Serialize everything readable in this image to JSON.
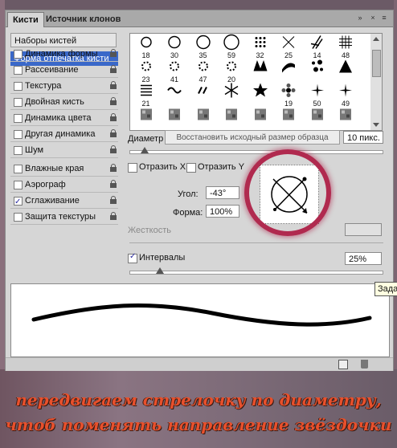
{
  "tabs": {
    "brushes": "Кисти",
    "clone_source": "Источник клонов"
  },
  "left_panel": {
    "presets_button": "Наборы кистей",
    "selected_item": "Форма отпечатка кисти",
    "items": [
      {
        "label": "Динамика формы",
        "checked": false
      },
      {
        "label": "Рассеивание",
        "checked": false
      },
      {
        "label": "Текстура",
        "checked": false
      },
      {
        "label": "Двойная кисть",
        "checked": false
      },
      {
        "label": "Динамика цвета",
        "checked": false
      },
      {
        "label": "Другая динамика",
        "checked": false
      },
      {
        "label": "Шум",
        "checked": false
      },
      {
        "label": "Влажные края",
        "checked": false
      },
      {
        "label": "Аэрограф",
        "checked": false
      },
      {
        "label": "Сглаживание",
        "checked": true
      },
      {
        "label": "Защита текстуры",
        "checked": false
      }
    ]
  },
  "brush_grid": {
    "rows": [
      [
        "18",
        "30",
        "35",
        "59",
        "32",
        "25",
        "14",
        "48"
      ],
      [
        "23",
        "41",
        "47",
        "20",
        "",
        "",
        "",
        ""
      ],
      [
        "21",
        "",
        "",
        "",
        "",
        "19",
        "50",
        "49"
      ],
      [
        "",
        "",
        "",
        "",
        "",
        "",
        "",
        ""
      ]
    ],
    "shapes": [
      [
        "circle",
        "circle",
        "circle",
        "circle",
        "dots",
        "x",
        "grass",
        "hash"
      ],
      [
        "splat",
        "splat",
        "splat",
        "splat",
        "zigzag",
        "streak",
        "scatter",
        "star-burst"
      ],
      [
        "hatch",
        "wave",
        "dash",
        "snowflake",
        "star",
        "flower",
        "sparkle",
        "sparkle"
      ],
      [
        "texture",
        "texture",
        "texture",
        "texture",
        "texture",
        "texture",
        "texture",
        "texture"
      ]
    ]
  },
  "diameter": {
    "label": "Диаметр",
    "reset_button": "Восстановить исходный размер образца",
    "value": "10 пикс.",
    "slider_fraction": 0.06
  },
  "flip": {
    "flip_x": "Отразить X",
    "flip_y": "Отразить Y"
  },
  "angle": {
    "label": "Угол:",
    "value": "-43°"
  },
  "roundness": {
    "label": "Форма:",
    "value": "100%"
  },
  "hardness": {
    "label": "Жесткость"
  },
  "spacing": {
    "label": "Интервалы",
    "checked": true,
    "value": "25%",
    "slider_fraction": 0.12
  },
  "tooltip": "Зада",
  "caption": {
    "line1": "передвигаем стрелочку по диаметру,",
    "line2": "чтоб поменять направление звёздочки"
  },
  "colors": {
    "highlight_ring": "#b02a4f",
    "selection": "#3a68c9",
    "caption": "#e8502c"
  }
}
